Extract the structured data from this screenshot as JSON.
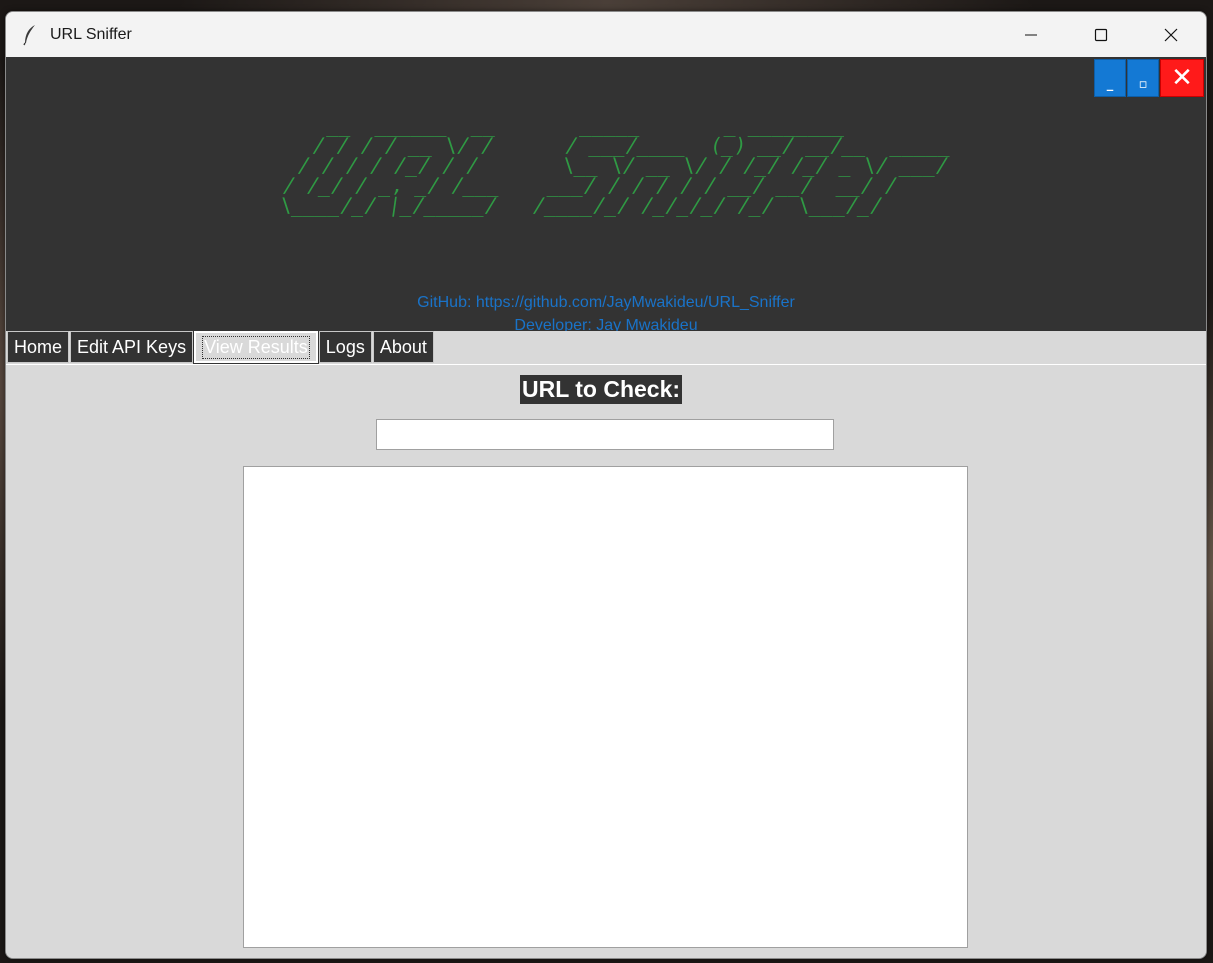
{
  "window": {
    "title": "URL Sniffer",
    "controls": {
      "minimize": "minimize-icon",
      "maximize": "maximize-icon",
      "close": "close-icon"
    }
  },
  "header": {
    "mini_buttons": {
      "minimize": "_",
      "maximize": "▫",
      "close": "✕"
    },
    "ascii_logo": "    __  ______  __       _____       _ ________         \n   / / / / __ \\/ /      / ___/____  (_) __/ __/__  _____\n  / / / / /_/ / /       \\__ \\/ __ \\/ / /_/ /_/ _ \\/ ___/\n / /_/ / _, _/ /___    ___/ / / / / / __/ __/  __/ /    \n \\____/_/ |_/_____/   /____/_/ /_/_/_/ /_/  \\___/_/     ",
    "github": "GitHub: https://github.com/JayMwakideu/URL_Sniffer",
    "developer": "Developer: Jay Mwakideu",
    "colors": {
      "background": "#333333",
      "logo": "#2f9a44",
      "link": "#1a73c8"
    }
  },
  "tabs": [
    {
      "label": "Home",
      "selected": false
    },
    {
      "label": "Edit API Keys",
      "selected": false
    },
    {
      "label": "View Results",
      "selected": true
    },
    {
      "label": "Logs",
      "selected": false
    },
    {
      "label": "About",
      "selected": false
    }
  ],
  "main": {
    "url_label": "URL to Check:",
    "url_input_value": "",
    "results_text": ""
  }
}
